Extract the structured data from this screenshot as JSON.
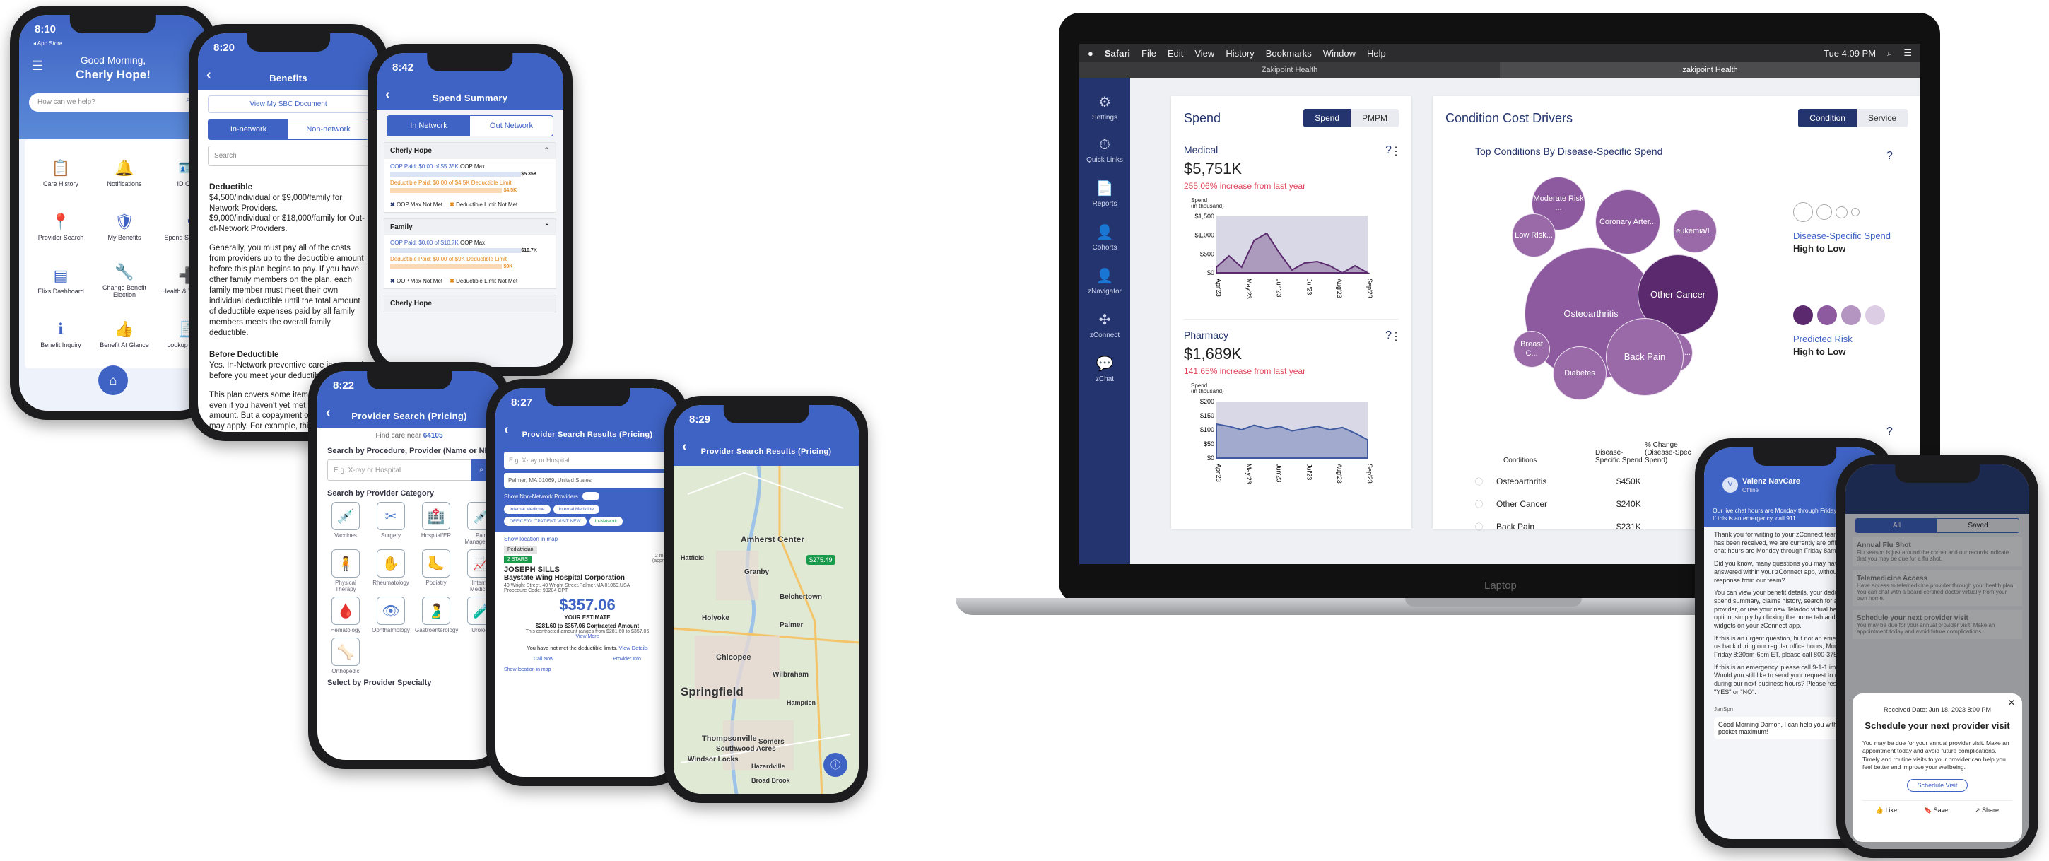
{
  "phone1": {
    "time": "8:10",
    "store": "◂ App Store",
    "greeting": "Good Morning,",
    "name": "Cherly Hope!",
    "search": "How can we help?",
    "tiles": [
      "Care History",
      "Notifications",
      "ID Card",
      "Provider Search",
      "My Benefits",
      "Spend Summary",
      "Elixs Dashboard",
      "Change Benefit Election",
      "Health & Wellness",
      "Benefit Inquiry",
      "Benefit At Glance",
      "Lookup Claims"
    ]
  },
  "phone2": {
    "time": "8:20",
    "store": "◂ App Store",
    "title": "Benefits",
    "link": "View My SBC Document",
    "tabs": [
      "In-network",
      "Non-network"
    ],
    "search": "Search",
    "h1": "Deductible",
    "p1": "$4,500/individual or $9,000/family for Network Providers.\n$9,000/individual or $18,000/family for Out-of-Network Providers.",
    "p2": "Generally, you must pay all of the costs from providers up to the deductible amount before this plan begins to pay. If you have other family members on the plan, each family member must meet their own individual deductible until the total amount of deductible expenses paid by all family members meets the overall family deductible.",
    "h2": "Before Deductible",
    "p3": "Yes. In-Network preventive care is covered before you meet your deductible.",
    "p4": "This plan covers some items and services even if you haven't yet met the deductible amount. But a copayment or coinsurance may apply. For example, this plan covers certain preventive"
  },
  "phone3": {
    "time": "8:42",
    "store": "◂ App Store",
    "title": "Spend Summary",
    "tabs": [
      "In Network",
      "Out Network"
    ],
    "g1": "Cherly Hope",
    "oop1": "OOP Paid: $0.00 of $5.35K",
    "oopmax": "OOP Max",
    "v1": "$5.35K",
    "ded1": "Deductible Paid: $0.00 of $4.5K",
    "dedl": "Deductible Limit",
    "v2": "$4.5K",
    "leg1": "OOP Max Not Met",
    "leg2": "Deductible Limit Not Met",
    "g2": "Family",
    "oop2": "OOP Paid: $0.00 of $10.7K",
    "v3": "$10.7K",
    "ded2": "Deductible Paid: $0.00 of $9K",
    "v4": "$9K",
    "g3": "Cherly Hope"
  },
  "phone4": {
    "time": "8:22",
    "store": "◂ App Store",
    "title": "Provider Search (Pricing)",
    "near": "Find care near",
    "zip": "64105",
    "q": "Search by Procedure, Provider (Name or NPI)",
    "ph": "E.g. X-ray or Hospital",
    "cat": "Search by Provider Category",
    "cats": [
      "Vaccines",
      "Surgery",
      "Hospital/ER",
      "Pain Management",
      "Physical Therapy",
      "Rheumatology",
      "Podiatry",
      "Internal Medicine",
      "Hematology",
      "Ophthalmology",
      "Gastroenterology",
      "Urology",
      "Orthopedic"
    ],
    "spec": "Select by Provider Specialty"
  },
  "phone5": {
    "time": "8:27",
    "title": "Provider Search Results (Pricing)",
    "ph": "E.g. X-ray or Hospital",
    "loc": "Palmer, MA 01069, United States",
    "toggle": "Show Non-Network Providers",
    "chips": [
      "Internal Medicine",
      "Internal Medicine",
      "OFFICE/OUTPATIENT VISIT NEW"
    ],
    "innet": "In-Network",
    "show": "Show location in map",
    "badge": "Pediatrician",
    "tag": "2 STARS",
    "name": "JOSEPH SILLS",
    "hosp": "Baystate Wing Hospital Corporation",
    "dist": "2 miles (approx)",
    "addr": "40 Wright Street, 40 Wright Street,Palmer,MA 01069,USA",
    "proc": "Procedure Code: 99204 CPT",
    "price": "$357.06",
    "est": "YOUR ESTIMATE",
    "range": "$281.60 to $357.06 Contracted Amount",
    "rng2": "This contracted amount ranges from $281.60 to $357.06",
    "more": "View More",
    "ded": "You have not met the deductible limits.",
    "det": "View Details",
    "call": "Call Now",
    "info": "Provider Info",
    "show2": "Show location in map"
  },
  "phone6": {
    "time": "8:29",
    "title": "Provider Search Results (Pricing)",
    "places": [
      "Amherst Center",
      "Hatfield",
      "Belchertown",
      "Granby",
      "Holyoke",
      "Palmer",
      "Chicopee",
      "Wilbraham",
      "Springfield",
      "Hampden",
      "Thompsonville",
      "Somers",
      "Southwood Acres",
      "Windsor Locks",
      "Hazardville",
      "Broad Brook"
    ],
    "pin": "$275.49"
  },
  "laptop": {
    "menu": [
      "Safari",
      "File",
      "Edit",
      "View",
      "History",
      "Bookmarks",
      "Window",
      "Help"
    ],
    "clock": "Tue 4:09 PM",
    "tab1": "Zakipoint Health",
    "tab2": "zakipoint Health",
    "brand": "Laptop",
    "side": [
      "Settings",
      "Quick Links",
      "Reports",
      "Cohorts",
      "zNavigator",
      "zConnect",
      "zChat"
    ],
    "spend": {
      "title": "Spend",
      "tg": [
        "Spend",
        "PMPM"
      ],
      "m_label": "Medical",
      "m_val": "$5,751K",
      "m_inc": "255.06% increase from last year",
      "axis": "Spend\n(in thousand)",
      "m_ticks": [
        "$1,500",
        "$1,000",
        "$500",
        "$0"
      ],
      "months": [
        "Apr'23",
        "May'23",
        "Jun'23",
        "Jul'23",
        "Aug'23",
        "Sep'23"
      ],
      "p_label": "Pharmacy",
      "p_val": "$1,689K",
      "p_inc": "141.65% increase from last year",
      "p_ticks": [
        "$200",
        "$150",
        "$100",
        "$50",
        "$0"
      ]
    },
    "ccd": {
      "title": "Condition Cost Drivers",
      "tg": [
        "Condition",
        "Service"
      ],
      "sub": "Top Conditions By Disease-Specific Spend",
      "bubbles": [
        "Moderate Risk ...",
        "Coronary Arter...",
        "Leukemia/L...",
        "Low Risk...",
        "Osteoarthritis",
        "Other Cancer",
        "Breast C...",
        "Cervical ...",
        "Diabetes",
        "Back Pain"
      ],
      "leg1": "Disease-Specific Spend",
      "leg1b": "High to Low",
      "leg2": "Predicted Risk",
      "leg2b": "High to Low",
      "th": [
        "Conditions",
        "Disease-Specific Spend",
        "% Change (Disease-Spec Spend)"
      ],
      "rows": [
        [
          "Osteoarthritis",
          "$450K"
        ],
        [
          "Other Cancer",
          "$240K"
        ],
        [
          "Back Pain",
          "$231K"
        ]
      ]
    }
  },
  "phone7": {
    "name": "Valenz NavCare",
    "status": "Offline",
    "banner": "Our live chat hours are Monday through Friday 8am-5pm ET. If this is an emergency, call 911.",
    "msgs": [
      "Thank you for writing to your zConnect team! Your chat has been received, we are currently are offline. Our live chat hours are Monday through Friday 8am-5pm ET.",
      "Did you know, many questions you may have can be answered within your zConnect app, without waiting for a response from our team?",
      "You can view your benefit details, your deductible status, spend summary, claims history, search for an in-network provider, or use your new Teladoc virtual health services option, simply by clicking the home tab and browsing the widgets on your zConnect app.",
      "If this is an urgent question, but not an emergency, call us back during our regular office hours, Monday through Friday 8:30am-6pm ET, please call 800-375-9173.",
      "If this is an emergency, please call 9-1-1 immediately.\nWould you still like to send your request to our team during our next business hours? Please respond with \"YES\" or \"NO\"."
    ],
    "sender": "JanSpn",
    "reply": "Good Morning Damon, I can help you with your out of pocket maximum!"
  },
  "phone8": {
    "tabs": [
      "All",
      "Saved"
    ],
    "items": [
      [
        "Annual Flu Shot",
        "Flu season is just around the corner and our records indicate that you may be due for a flu shot."
      ],
      [
        "Telemedicine Access",
        "Have access to telemedicine provider through your health plan. You can chat with a board-certified doctor virtually from your own home."
      ],
      [
        "Schedule your next provider visit",
        "You may be due for your annual provider visit. Make an appointment today and avoid future complications."
      ]
    ],
    "date": "Received Date: Jun 18, 2023 8:00 PM",
    "mtitle": "Schedule your next provider visit",
    "mbody": "You may be due for your annual provider visit. Make an appointment today and avoid future complications. Timely and routine visits to your provider can help you feel better and improve your wellbeing.",
    "btn": "Schedule Visit",
    "acts": [
      "Like",
      "Save",
      "Share"
    ]
  },
  "colors": {
    "appBlue": "#3f63c4",
    "navy": "#24346e",
    "bubble": "#9a6aa8",
    "bubbleDark": "#5b2a6e",
    "red": "#e0455a"
  }
}
